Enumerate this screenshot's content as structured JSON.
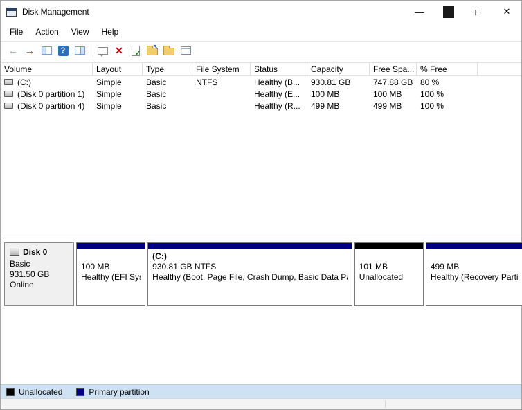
{
  "window": {
    "title": "Disk Management",
    "controls": {
      "minimize": "—",
      "maximize": "□",
      "close": "✕"
    }
  },
  "menu": {
    "items": [
      "File",
      "Action",
      "View",
      "Help"
    ]
  },
  "toolbar": {
    "icons": [
      "back-icon",
      "forward-icon",
      "show-console-tree-icon",
      "help-icon",
      "show-action-pane-icon",
      "popup-window-icon",
      "delete-icon",
      "properties-icon",
      "folder-up-icon",
      "folder-icon",
      "list-columns-icon"
    ],
    "glyphs": {
      "back": "←",
      "forward": "→",
      "help": "?",
      "delete": "✕",
      "check": "✓",
      "up": "↖"
    }
  },
  "table": {
    "columns": [
      "Volume",
      "Layout",
      "Type",
      "File System",
      "Status",
      "Capacity",
      "Free Spa...",
      "% Free"
    ],
    "rows": [
      {
        "volume": "(C:)",
        "layout": "Simple",
        "type": "Basic",
        "fs": "NTFS",
        "status": "Healthy (B...",
        "capacity": "930.81 GB",
        "free": "747.88 GB",
        "pct": "80 %"
      },
      {
        "volume": "(Disk 0 partition 1)",
        "layout": "Simple",
        "type": "Basic",
        "fs": "",
        "status": "Healthy (E...",
        "capacity": "100 MB",
        "free": "100 MB",
        "pct": "100 %"
      },
      {
        "volume": "(Disk 0 partition 4)",
        "layout": "Simple",
        "type": "Basic",
        "fs": "",
        "status": "Healthy (R...",
        "capacity": "499 MB",
        "free": "499 MB",
        "pct": "100 %"
      }
    ]
  },
  "disk": {
    "name": "Disk 0",
    "type": "Basic",
    "size": "931.50 GB",
    "status": "Online",
    "partitions": [
      {
        "title": "",
        "line1": "100 MB",
        "line2": "Healthy (EFI Syst",
        "color": "#000080"
      },
      {
        "title": "(C:)",
        "line1": "930.81 GB NTFS",
        "line2": "Healthy (Boot, Page File, Crash Dump, Basic Data Parti",
        "color": "#000080"
      },
      {
        "title": "",
        "line1": "101 MB",
        "line2": "Unallocated",
        "color": "#000000"
      },
      {
        "title": "",
        "line1": "499 MB",
        "line2": "Healthy (Recovery Parti",
        "color": "#000080"
      }
    ]
  },
  "legend": {
    "items": [
      {
        "label": "Unallocated",
        "color": "#000000"
      },
      {
        "label": "Primary partition",
        "color": "#000080"
      }
    ]
  },
  "colors": {
    "accent_navy": "#000080",
    "unallocated_black": "#000000"
  }
}
